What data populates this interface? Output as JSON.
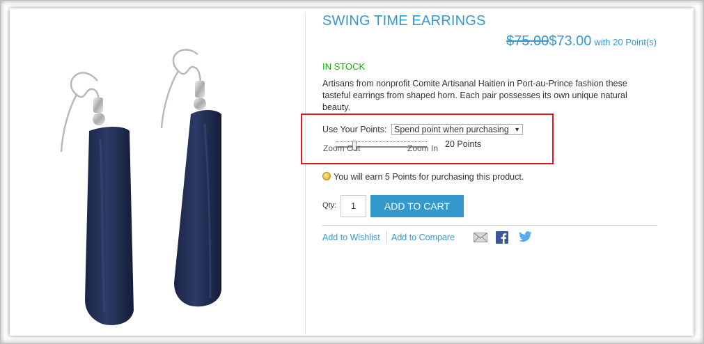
{
  "product": {
    "title": "SWING TIME EARRINGS",
    "old_price": "$75.00",
    "new_price": "$73.00",
    "points_note": "with 20 Point(s)",
    "stock": "IN STOCK",
    "description": "Artisans from nonprofit Comite Artisanal Haitien in Port-au-Prince fashion these tasteful earrings from shaped horn. Each pair possesses its own unique natural beauty."
  },
  "points": {
    "use_label": "Use Your Points:",
    "select_value": "Spend point when purchasing",
    "zoom_out": "Zoom Out",
    "zoom_in": "Zoom In",
    "slider_value_text": "20 Points",
    "slider_fraction": 0.2,
    "earn_text": "You will earn 5 Points for purchasing this product."
  },
  "cart": {
    "qty_label": "Qty:",
    "qty_value": "1",
    "add_to_cart": "ADD TO CART"
  },
  "links": {
    "wishlist": "Add to Wishlist",
    "compare": "Add to Compare"
  },
  "icons": [
    "earring-image",
    "coin-icon",
    "mail-icon",
    "facebook-icon",
    "twitter-icon",
    "dropdown-arrow-icon"
  ],
  "colors": {
    "accent": "#3399cc",
    "in_stock": "#11b400",
    "highlight_box": "#e0161f",
    "earring": "#1f2b4d"
  }
}
